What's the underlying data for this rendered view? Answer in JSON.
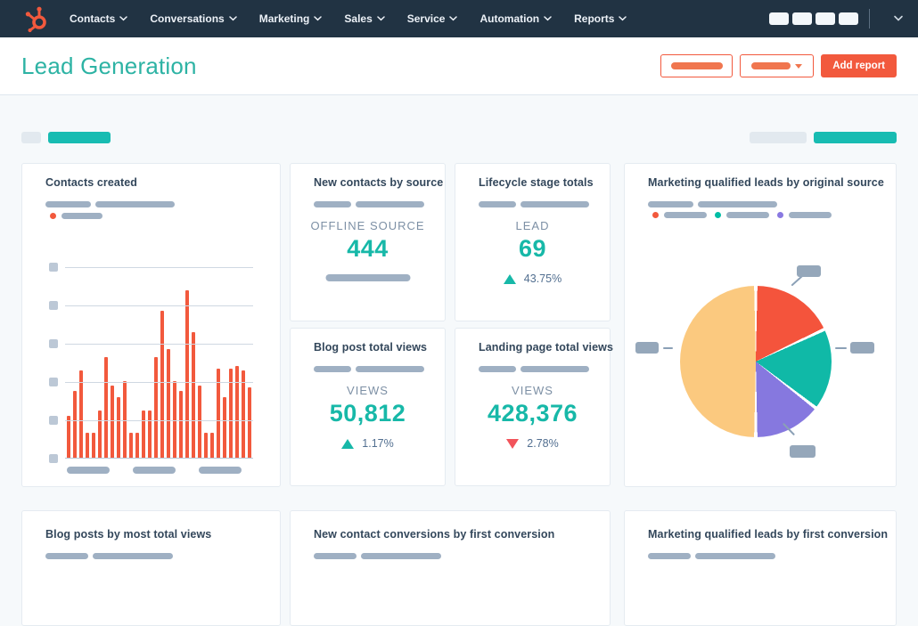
{
  "nav": {
    "brand": "HubSpot",
    "items": [
      {
        "label": "Contacts"
      },
      {
        "label": "Conversations"
      },
      {
        "label": "Marketing"
      },
      {
        "label": "Sales"
      },
      {
        "label": "Service"
      },
      {
        "label": "Automation"
      },
      {
        "label": "Reports"
      }
    ],
    "action_placeholder_count": 4
  },
  "header": {
    "title": "Lead Generation",
    "buttons": {
      "add_report": "Add report"
    }
  },
  "cards": {
    "contacts_created": {
      "title": "Contacts created"
    },
    "new_contacts_by_source": {
      "title": "New contacts by source",
      "metric_label": "OFFLINE SOURCE",
      "value": "444"
    },
    "lifecycle_stage_totals": {
      "title": "Lifecycle stage totals",
      "metric_label": "LEAD",
      "value": "69",
      "delta": "43.75%",
      "delta_direction": "up"
    },
    "mql_by_original_source": {
      "title": "Marketing qualified leads by original source"
    },
    "blog_post_total_views": {
      "title": "Blog post total views",
      "metric_label": "VIEWS",
      "value": "50,812",
      "delta": "1.17%",
      "delta_direction": "up"
    },
    "landing_page_total_views": {
      "title": "Landing page total views",
      "metric_label": "VIEWS",
      "value": "428,376",
      "delta": "2.78%",
      "delta_direction": "down"
    },
    "blog_posts_by_most_total_views": {
      "title": "Blog posts by most total views"
    },
    "new_contact_conversions_by_first_conversion": {
      "title": "New contact conversions by first conversion"
    },
    "mql_by_first_conversion": {
      "title": "Marketing qualified leads by first conversion"
    }
  },
  "chart_data": [
    {
      "type": "bar",
      "title": "Contacts created",
      "values_unit": "percent of tallest bar (axis tick labels are redacted placeholder pills in the source UI)",
      "series": [
        {
          "name": "contacts-created-daily",
          "color": "#f2593d",
          "values": [
            25,
            40,
            52,
            15,
            15,
            28,
            60,
            43,
            36,
            46,
            15,
            15,
            28,
            28,
            60,
            88,
            65,
            46,
            40,
            100,
            75,
            43,
            15,
            15,
            53,
            36,
            53,
            55,
            52,
            42
          ]
        }
      ],
      "x_tick_label_placeholders": 3,
      "y_tick_label_placeholders": 6,
      "grid": true,
      "legend_position": "top-left"
    },
    {
      "type": "pie",
      "title": "Marketing qualified leads by original source",
      "start_angle_deg": 0,
      "slices": [
        {
          "label": "slice-1 (label redacted)",
          "percent": 18,
          "color": "#f4543c"
        },
        {
          "label": "slice-2 (label redacted)",
          "percent": 17.5,
          "color": "#10b9a7"
        },
        {
          "label": "slice-3 (label redacted)",
          "percent": 14.5,
          "color": "#8678df"
        },
        {
          "label": "slice-4 (label redacted)",
          "percent": 50,
          "color": "#fbc97f"
        }
      ],
      "legend_colors": [
        "#f2593d",
        "#00bda5",
        "#8979e1"
      ],
      "legend_position": "top-left",
      "callout_labels": "redacted placeholder pills"
    }
  ],
  "colors": {
    "nav_background": "#213343",
    "page_background": "#f6f9fb",
    "accent_orange": "#f2593d",
    "accent_teal": "#17b8a8",
    "heading_teal": "#2db3a4",
    "negative_red": "#f2545b",
    "chip_teal": "#18bcb2",
    "placeholder_gray": "#9fb0c3",
    "title_navy": "#33475b"
  }
}
